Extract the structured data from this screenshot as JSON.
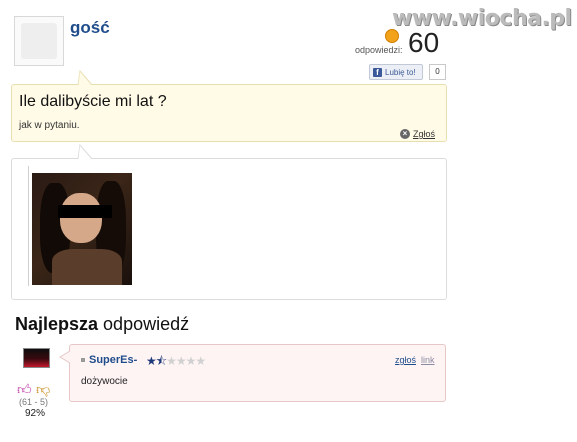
{
  "watermark": "www.wiocha.pl",
  "question": {
    "author": "gość",
    "answers_label": "odpowiedzi:",
    "answers_count": "60",
    "like_label": "Lubię to!",
    "like_count": "0",
    "title": "Ile dalibyście mi lat ?",
    "body": "jak w pytaniu.",
    "report_label": "Zgłoś"
  },
  "best_answer": {
    "heading_bold": "Najlepsza",
    "heading_rest": " odpowiedź",
    "user": "SuperEs-",
    "rating_stars": 1.5,
    "rating_max": 5,
    "report_label": "zgłoś",
    "link_label": "link",
    "text": "dożywocie",
    "votes": "(61 - 5)",
    "percent": "92%"
  },
  "colors": {
    "author_blue": "#1f4d8c",
    "question_bg": "#fffbe6",
    "answer_bg": "#fff4f4"
  },
  "icons": {
    "report": "close-circle-icon",
    "thumb_up": "thumb-up-icon",
    "thumb_down": "thumb-down-icon",
    "facebook": "facebook-icon",
    "coin": "coin-icon"
  }
}
